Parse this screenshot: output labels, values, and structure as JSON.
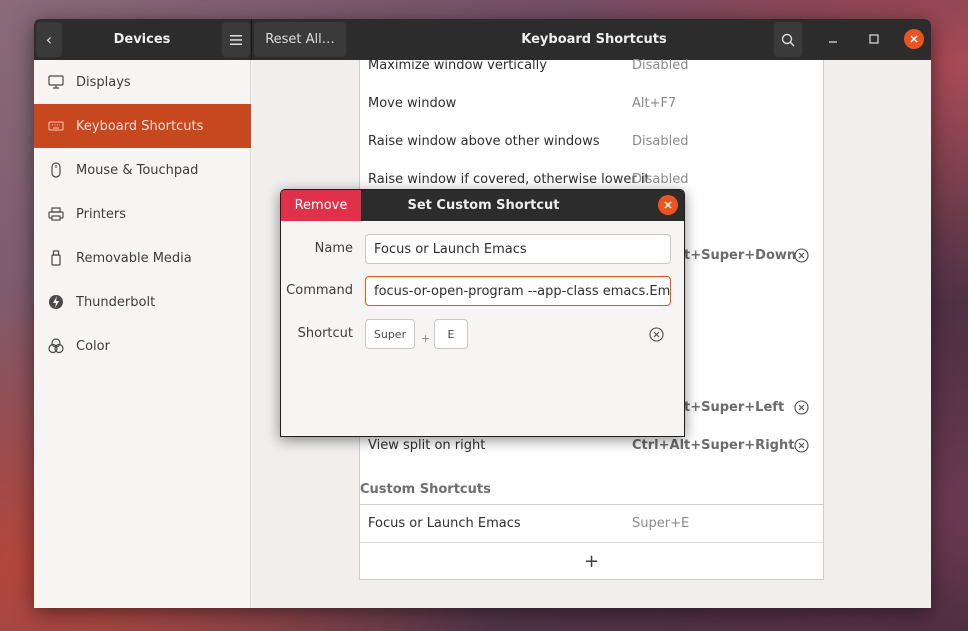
{
  "headerbar": {
    "left_title": "Devices",
    "reset_label": "Reset All…",
    "title": "Keyboard Shortcuts"
  },
  "sidebar": {
    "items": [
      {
        "label": "Displays",
        "icon": "display-icon"
      },
      {
        "label": "Keyboard Shortcuts",
        "icon": "keyboard-icon",
        "active": true
      },
      {
        "label": "Mouse & Touchpad",
        "icon": "mouse-icon"
      },
      {
        "label": "Printers",
        "icon": "printer-icon"
      },
      {
        "label": "Removable Media",
        "icon": "usb-drive-icon"
      },
      {
        "label": "Thunderbolt",
        "icon": "thunderbolt-icon"
      },
      {
        "label": "Color",
        "icon": "color-icon"
      }
    ]
  },
  "shortcuts": {
    "rows": [
      {
        "label": "Maximize window vertically",
        "accel": "Disabled"
      },
      {
        "label": "Move window",
        "accel": "Alt+F7"
      },
      {
        "label": "Raise window above other windows",
        "accel": "Disabled"
      },
      {
        "label": "Raise window if covered, otherwise lower it",
        "accel": "Disabled"
      },
      {
        "label": "",
        "accel": "Ctrl+Alt+Super+Down"
      },
      {
        "label": "",
        "accel": "Ctrl+Alt+Super+Left"
      },
      {
        "label": "View split on right",
        "accel": "Ctrl+Alt+Super+Right"
      }
    ],
    "custom_section_label": "Custom Shortcuts",
    "custom_rows": [
      {
        "label": "Focus or Launch Emacs",
        "accel": "Super+E"
      }
    ],
    "add_label": "+"
  },
  "dialog": {
    "remove_label": "Remove",
    "title": "Set Custom Shortcut",
    "name_label": "Name",
    "name_value": "Focus or Launch Emacs",
    "command_label": "Command",
    "command_value": "focus-or-open-program --app-class emacs.Emacs --app",
    "shortcut_label": "Shortcut",
    "keys": [
      "Super",
      "E"
    ],
    "key_separator": "+"
  },
  "colors": {
    "accent": "#e95420",
    "sidebar_active": "#c7481f",
    "remove_button": "#e0304a",
    "headerbar": "#2c2c2c"
  }
}
